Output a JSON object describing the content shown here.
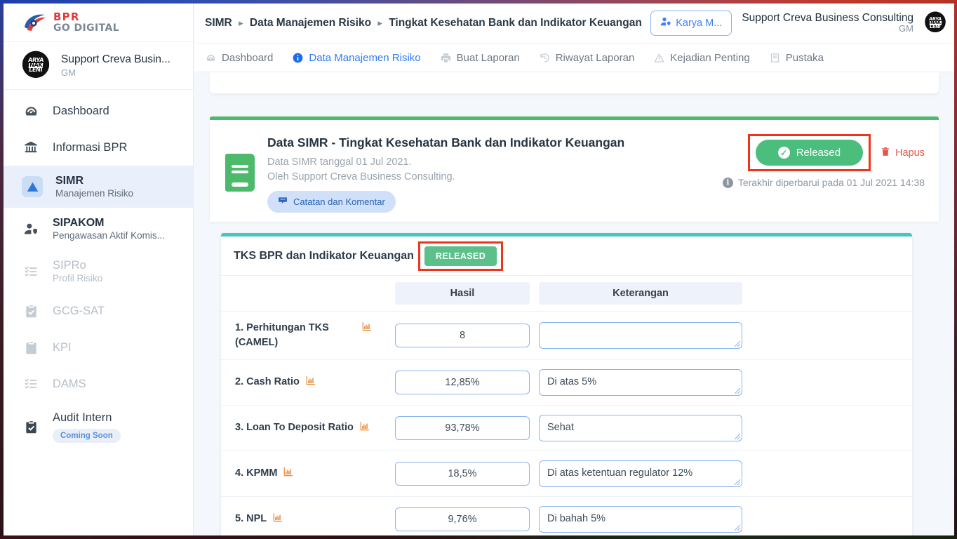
{
  "brand": {
    "line1": "BPR",
    "line2": "GO DIGITAL",
    "logo_icon": "bpr-swoosh-logo"
  },
  "sidebar": {
    "profile": {
      "name": "Support Creva Busin...",
      "role": "GM",
      "avatar_icon": "user-avatar"
    },
    "items": [
      {
        "label": "Dashboard",
        "sub": "",
        "icon": "speedometer-icon",
        "state": "normal"
      },
      {
        "label": "Informasi BPR",
        "sub": "",
        "icon": "bank-icon",
        "state": "normal"
      },
      {
        "label": "SIMR",
        "sub": "Manajemen Risiko",
        "icon": "warning-triangle-icon",
        "state": "active"
      },
      {
        "label": "SIPAKOM",
        "sub": "Pengawasan Aktif Komis...",
        "icon": "user-shield-icon",
        "state": "normal"
      },
      {
        "label": "SIPRo",
        "sub": "Profil Risiko",
        "icon": "checklist-icon",
        "state": "disabled"
      },
      {
        "label": "GCG-SAT",
        "sub": "",
        "icon": "clipboard-check-icon",
        "state": "disabled"
      },
      {
        "label": "KPI",
        "sub": "",
        "icon": "clipboard-list-icon",
        "state": "disabled"
      },
      {
        "label": "DAMS",
        "sub": "",
        "icon": "checklist-icon",
        "state": "disabled"
      },
      {
        "label": "Audit Intern",
        "sub": "",
        "icon": "clipboard-check-icon",
        "state": "normal",
        "badge": "Coming Soon"
      }
    ]
  },
  "topbar": {
    "breadcrumb": [
      "SIMR",
      "Data Manajemen Risiko",
      "Tingkat Kesehatan Bank dan Indikator Keuangan"
    ],
    "karya_button": {
      "label": "Karya M...",
      "icon": "user-shield-icon"
    },
    "account": {
      "name": "Support Creva Business Consulting",
      "role": "GM",
      "avatar_icon": "user-avatar"
    }
  },
  "tabs": [
    {
      "label": "Dashboard",
      "icon": "speedometer-icon",
      "active": false
    },
    {
      "label": "Data Manajemen Risiko",
      "icon": "info-circle-icon",
      "active": true
    },
    {
      "label": "Buat Laporan",
      "icon": "printer-icon",
      "active": false
    },
    {
      "label": "Riwayat Laporan",
      "icon": "history-icon",
      "active": false
    },
    {
      "label": "Kejadian Penting",
      "icon": "warning-triangle-icon",
      "active": false
    },
    {
      "label": "Pustaka",
      "icon": "book-icon",
      "active": false
    }
  ],
  "simr_card": {
    "icon": "green-book-icon",
    "title": "Data SIMR - Tingkat Kesehatan Bank dan Indikator Keuangan",
    "subtitle_line1": "Data SIMR tanggal 01 Jul 2021.",
    "subtitle_line2": "Oleh Support Creva Business Consulting.",
    "notes_button": {
      "label": "Catatan dan Komentar",
      "icon": "comment-box-icon"
    },
    "released_button": {
      "label": "Released",
      "icon": "check-circle-icon"
    },
    "delete_button": {
      "label": "Hapus",
      "icon": "trash-icon"
    },
    "last_updated": "Terakhir diperbarui pada 01 Jul 2021 14:38",
    "last_updated_icon": "info-circle-icon",
    "accent_color": "#4cb96b",
    "released_color": "#4bbd7c",
    "delete_color": "#e2574c"
  },
  "tks_card": {
    "title": "TKS BPR dan Indikator Keuangan",
    "status_badge": "RELEASED",
    "status_badge_color": "#5cc08a",
    "accent_color": "#45c5c0",
    "highlight_color": "#f0341a",
    "columns": [
      "",
      "Hasil",
      "Keterangan"
    ],
    "rows": [
      {
        "label": "1. Perhitungan TKS (CAMEL)",
        "icon": "bar-chart-icon",
        "hasil": "8",
        "keterangan": ""
      },
      {
        "label": "2. Cash Ratio",
        "icon": "bar-chart-icon",
        "hasil": "12,85%",
        "keterangan": "Di atas 5%"
      },
      {
        "label": "3. Loan To Deposit Ratio",
        "icon": "bar-chart-icon",
        "hasil": "93,78%",
        "keterangan": "Sehat"
      },
      {
        "label": "4. KPMM",
        "icon": "bar-chart-icon",
        "hasil": "18,5%",
        "keterangan": "Di atas ketentuan regulator 12%"
      },
      {
        "label": "5. NPL",
        "icon": "bar-chart-icon",
        "hasil": "9,76%",
        "keterangan": "Di bahah 5%"
      }
    ]
  }
}
